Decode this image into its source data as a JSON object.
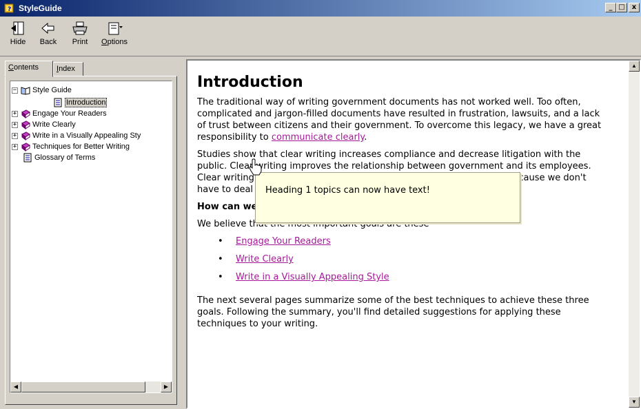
{
  "window": {
    "title": "StyleGuide",
    "minimize": "_",
    "maximize": "□",
    "close": "x"
  },
  "toolbar": {
    "hide": {
      "pre": "",
      "ul": "",
      "post": "Hide"
    },
    "back": {
      "pre": "",
      "ul": "",
      "post": "Back"
    },
    "print": {
      "pre": "",
      "ul": "",
      "post": "Print"
    },
    "options": {
      "pre": "",
      "ul": "O",
      "post": "ptions"
    }
  },
  "tabs": {
    "contents": {
      "ul": "C",
      "post": "ontents"
    },
    "index": {
      "ul": "I",
      "post": "ndex"
    }
  },
  "tree": {
    "style_guide": "Style Guide",
    "introduction": "Introduction",
    "engage": "Engage Your Readers",
    "write_clearly": "Write Clearly",
    "visually": "Write in a Visually Appealing Sty",
    "techniques": "Techniques for Better Writing",
    "glossary": "Glossary of Terms"
  },
  "content": {
    "heading": "Introduction",
    "p1_text": "The traditional way of writing government documents has not worked well. Too often, complicated and jargon-filled documents have resulted in frustration, lawsuits, and a lack of trust between citizens and their government. To overcome this legacy, we have a great responsibility to ",
    "p1_link": "communicate clearly",
    "p1_end": ".",
    "p2_text": "Studies show that clear writing increases compliance and decrease litigation with the public. Clear writing improves the relationship between government and its employees. Clear writing reduces the amount of time spent on a communication because we don't have to deal with the consequences of unclear communication.",
    "subheading": "How can we be better writers?",
    "p3_text": "We believe that the most important goals are these—",
    "bullets": [
      "Engage Your Readers",
      "Write Clearly",
      "Write in a Visually Appealing Style"
    ],
    "bullet_char": "•",
    "p4_text": "The next several pages summarize some of the best techniques to achieve these three goals. Following the summary, you'll find detailed suggestions for applying these techniques to your writing."
  },
  "popup": {
    "text": "Heading 1 topics can now have text!"
  },
  "colors": {
    "link": "#a6189a",
    "popup_bg": "#ffffe1",
    "titlebar": "#0a246a"
  }
}
